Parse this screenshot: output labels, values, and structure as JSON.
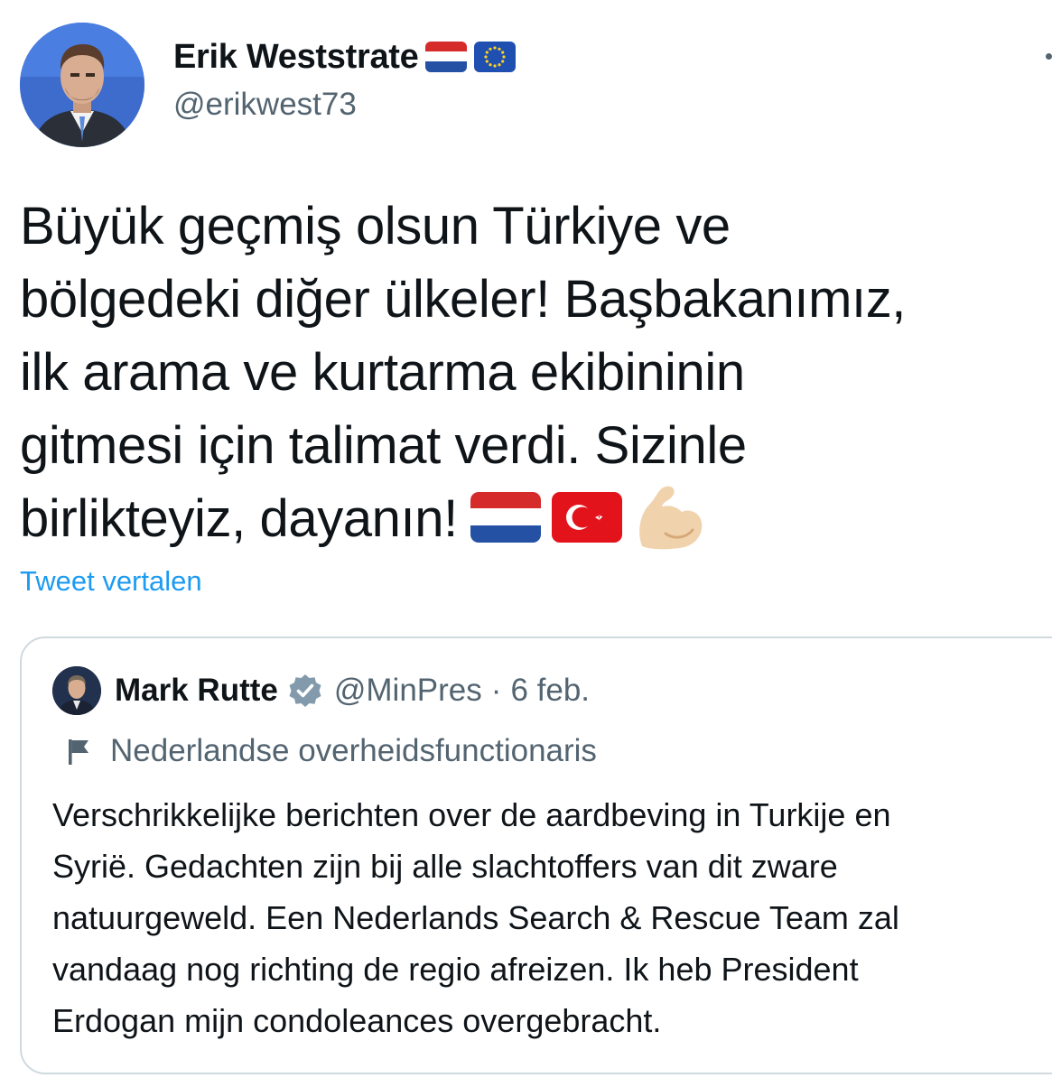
{
  "author": {
    "name": "Erik Weststrate",
    "handle": "@erikwest73",
    "name_flags": [
      "netherlands-flag",
      "eu-flag"
    ]
  },
  "tweet": {
    "lines": [
      "Büyük geçmiş olsun Türkiye ve",
      "bölgedeki diğer ülkeler! Başbakanımız,",
      "ilk arama ve kurtarma ekibininin",
      "gitmesi için talimat verdi. Sizinle",
      "birlikteyiz, dayanın!"
    ],
    "emojis": [
      "netherlands-flag",
      "turkey-flag",
      "flexed-biceps"
    ],
    "translate_label": "Tweet vertalen"
  },
  "quote": {
    "name": "Mark Rutte",
    "handle": "@MinPres",
    "separator": "·",
    "date": "6 feb.",
    "label": "Nederlandse overheidsfunctionaris",
    "lines": [
      "Verschrikkelijke berichten over de aardbeving in Turkije en",
      "Syrië. Gedachten zijn bij alle slachtoffers van dit zware",
      "natuurgeweld. Een Nederlands Search & Rescue Team zal",
      "vandaag nog richting de regio afreizen. Ik heb President",
      "Erdogan mijn condoleances overgebracht."
    ]
  },
  "colors": {
    "text": "#0f1419",
    "secondary": "#536471",
    "link": "#1d9bf0",
    "border": "#cfd9de",
    "verified_badge": "#829aab"
  }
}
